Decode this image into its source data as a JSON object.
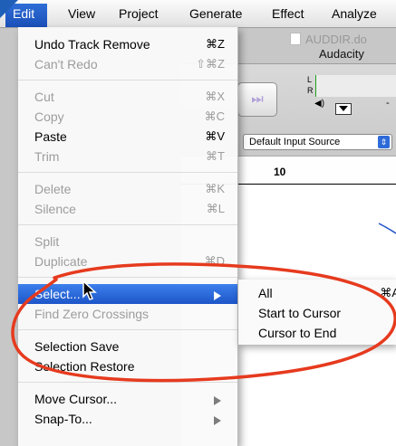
{
  "menubar": {
    "items": [
      {
        "label": "Edit"
      },
      {
        "label": "View"
      },
      {
        "label": "Project"
      },
      {
        "label": "Generate"
      },
      {
        "label": "Effect"
      },
      {
        "label": "Analyze"
      }
    ]
  },
  "window": {
    "doc_title": "AUDDIR.do",
    "app_title": "Audacity"
  },
  "toolbar": {
    "meter_left": "L",
    "meter_right": "R",
    "meter_tick": "-",
    "input_source": "Default Input Source",
    "input_source_arrow": "⇕",
    "ruler_label": "10",
    "skip_glyph": "⏭"
  },
  "edit_menu": {
    "items": [
      {
        "label": "Undo Track Remove",
        "shortcut": "⌘Z",
        "enabled": true
      },
      {
        "label": "Can't Redo",
        "shortcut": "⇧⌘Z",
        "enabled": false
      },
      {
        "label": "Cut",
        "shortcut": "⌘X",
        "enabled": false
      },
      {
        "label": "Copy",
        "shortcut": "⌘C",
        "enabled": false
      },
      {
        "label": "Paste",
        "shortcut": "⌘V",
        "enabled": true
      },
      {
        "label": "Trim",
        "shortcut": "⌘T",
        "enabled": false
      },
      {
        "label": "Delete",
        "shortcut": "⌘K",
        "enabled": false
      },
      {
        "label": "Silence",
        "shortcut": "⌘L",
        "enabled": false
      },
      {
        "label": "Split",
        "shortcut": "",
        "enabled": false
      },
      {
        "label": "Duplicate",
        "shortcut": "⌘D",
        "enabled": false
      },
      {
        "label": "Select...",
        "shortcut": "",
        "enabled": true,
        "highlighted": true,
        "has_submenu": true
      },
      {
        "label": "Find Zero Crossings",
        "shortcut": "",
        "enabled": false
      },
      {
        "label": "Selection Save",
        "shortcut": "",
        "enabled": true
      },
      {
        "label": "Selection Restore",
        "shortcut": "",
        "enabled": true
      },
      {
        "label": "Move Cursor...",
        "shortcut": "",
        "enabled": true,
        "has_submenu": true
      },
      {
        "label": "Snap-To...",
        "shortcut": "",
        "enabled": true,
        "has_submenu": true
      }
    ]
  },
  "select_submenu": {
    "items": [
      {
        "label": "All",
        "shortcut": "⌘A"
      },
      {
        "label": "Start to Cursor",
        "shortcut": ""
      },
      {
        "label": "Cursor to End",
        "shortcut": ""
      }
    ]
  },
  "colors": {
    "highlight_blue": "#1d55c8",
    "annotation_red": "#e63a1e",
    "disabled_text": "#9d9d9d"
  },
  "icons": [
    "mouse-pointer-icon",
    "submenu-arrow-icon",
    "speaker-icon",
    "skip-to-end-icon",
    "dropdown-arrow-icon"
  ]
}
